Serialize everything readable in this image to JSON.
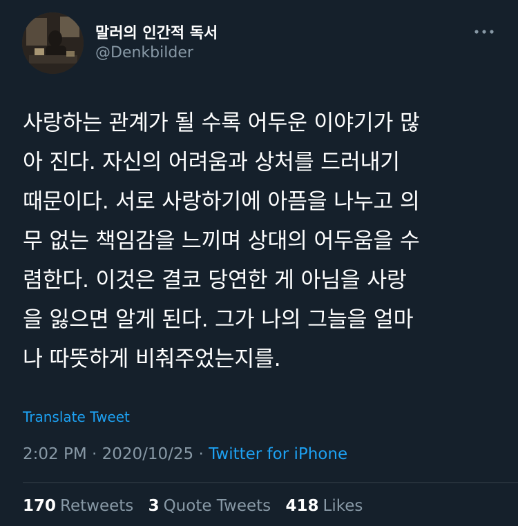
{
  "author": {
    "display_name": "말러의 인간적 독서",
    "handle": "@Denkbilder"
  },
  "tweet": {
    "lines": [
      "사랑하는 관계가 될 수록 어두운 이야기가 많",
      "아 진다. 자신의 어려움과 상처를 드러내기",
      "때문이다. 서로 사랑하기에 아픔을 나누고 의",
      "무 없는 책임감을 느끼며 상대의 어두움을 수",
      "렴한다. 이것은 결코 당연한 게 아님을 사랑",
      "을 잃으면 알게 된다. 그가 나의 그늘을 얼마",
      "나 따뜻하게 비춰주었는지를."
    ],
    "translate_label": "Translate Tweet",
    "time": "2:02 PM",
    "separator": "·",
    "date": "2020/10/25",
    "source": "Twitter for iPhone"
  },
  "stats": {
    "retweets_count": "170",
    "retweets_label": "Retweets",
    "quotes_count": "3",
    "quotes_label": "Quote Tweets",
    "likes_count": "418",
    "likes_label": "Likes"
  },
  "colors": {
    "background": "#15202b",
    "accent": "#1da1f2",
    "secondary_text": "#8899a6",
    "divider": "#38444d"
  },
  "icons": {
    "more": "more-horizontal-icon"
  }
}
